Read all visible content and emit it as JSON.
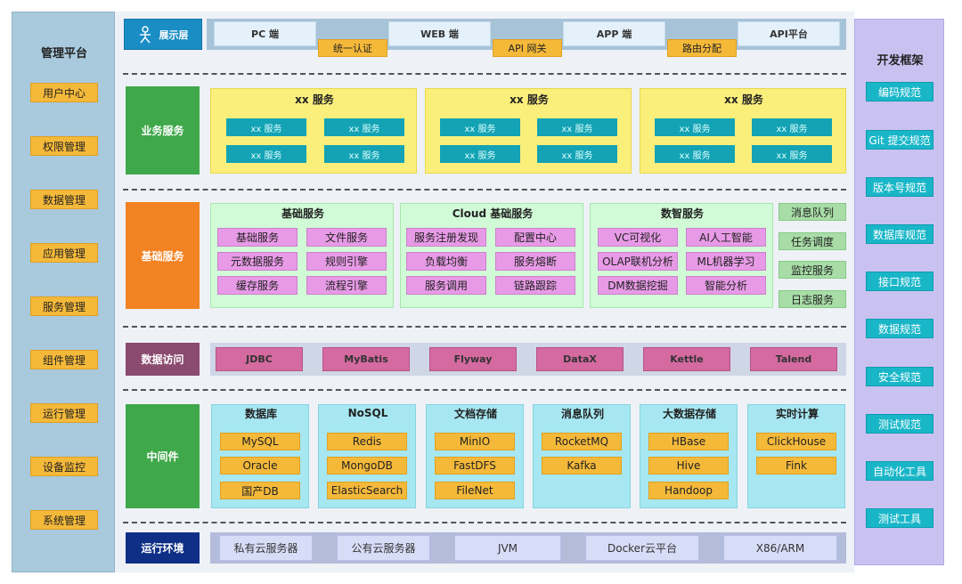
{
  "left": {
    "title": "管理平台",
    "items": [
      "用户中心",
      "权限管理",
      "数据管理",
      "应用管理",
      "服务管理",
      "组件管理",
      "运行管理",
      "设备监控",
      "系统管理"
    ]
  },
  "right": {
    "title": "开发框架",
    "items": [
      "编码规范",
      "Git 提交规范",
      "版本号规范",
      "数据库规范",
      "接口规范",
      "数据规范",
      "安全规范",
      "测试规范",
      "自动化工具",
      "测试工具"
    ]
  },
  "presentation": {
    "label": "展示层",
    "clients": [
      "PC 端",
      "WEB 端",
      "APP 端",
      "API平台"
    ],
    "joins": [
      "统一认证",
      "API 网关",
      "路由分配"
    ]
  },
  "business": {
    "label": "业务服务",
    "panel_title": "xx 服务",
    "chip": "xx 服务"
  },
  "foundation": {
    "label": "基础服务",
    "panels": [
      {
        "title": "基础服务",
        "chips": [
          "基础服务",
          "文件服务",
          "元数据服务",
          "规则引擎",
          "缓存服务",
          "流程引擎"
        ]
      },
      {
        "title": "Cloud 基础服务",
        "chips": [
          "服务注册发现",
          "配置中心",
          "负载均衡",
          "服务熔断",
          "服务调用",
          "链路跟踪"
        ]
      },
      {
        "title": "数智服务",
        "chips": [
          "VC可视化",
          "AI人工智能",
          "OLAP联机分析",
          "ML机器学习",
          "DM数据挖掘",
          "智能分析"
        ]
      }
    ],
    "side": [
      "消息队列",
      "任务调度",
      "监控服务",
      "日志服务"
    ]
  },
  "data_access": {
    "label": "数据访问",
    "items": [
      "JDBC",
      "MyBatis",
      "Flyway",
      "DataX",
      "Kettle",
      "Talend"
    ]
  },
  "middleware": {
    "label": "中间件",
    "groups": [
      {
        "title": "数据库",
        "items": [
          "MySQL",
          "Oracle",
          "国产DB"
        ]
      },
      {
        "title": "NoSQL",
        "items": [
          "Redis",
          "MongoDB",
          "ElasticSearch"
        ]
      },
      {
        "title": "文档存储",
        "items": [
          "MinIO",
          "FastDFS",
          "FileNet"
        ]
      },
      {
        "title": "消息队列",
        "items": [
          "RocketMQ",
          "Kafka"
        ]
      },
      {
        "title": "大数据存储",
        "items": [
          "HBase",
          "Hive",
          "Handoop"
        ]
      },
      {
        "title": "实时计算",
        "items": [
          "ClickHouse",
          "Fink"
        ]
      }
    ]
  },
  "runtime": {
    "label": "运行环境",
    "items": [
      "私有云服务器",
      "公有云服务器",
      "JVM",
      "Docker云平台",
      "X86/ARM"
    ]
  },
  "colors": {
    "orange": "#f5b93a",
    "teal": "#19b6c8",
    "green_label": "#3fa84a",
    "orange_label": "#f28222",
    "purple_label": "#8b4a6f",
    "navy_label": "#0f2f86"
  }
}
